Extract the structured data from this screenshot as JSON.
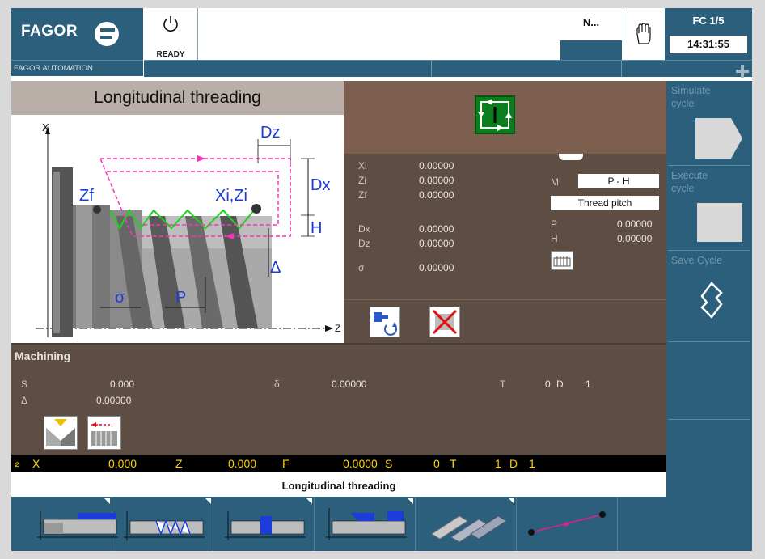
{
  "header": {
    "brand": "FAGOR",
    "brand_sub": "FAGOR AUTOMATION",
    "status": "READY",
    "message": "",
    "n_label": "N...",
    "fc_label": "FC 1/5",
    "time": "14:31:55"
  },
  "cycle": {
    "title": "Longitudinal threading",
    "footer_name": "Longitudinal threading"
  },
  "diagram_labels": {
    "x_axis": "X",
    "z_axis": "Z",
    "dz": "Dz",
    "dx": "Dx",
    "h": "H",
    "zf": "Zf",
    "xi_zi": "Xi,Zi",
    "delta": "Δ",
    "sigma": "σ",
    "p": "P"
  },
  "params": {
    "xi": {
      "label": "Xi",
      "value": "0.00000"
    },
    "zi": {
      "label": "Zi",
      "value": "0.00000"
    },
    "zf": {
      "label": "Zf",
      "value": "0.00000"
    },
    "dx": {
      "label": "Dx",
      "value": "0.00000"
    },
    "dz": {
      "label": "Dz",
      "value": "0.00000"
    },
    "sigma": {
      "label": "σ",
      "value": "0.00000"
    },
    "m": {
      "label": "M",
      "value": "P - H"
    },
    "thread_mode": "Thread pitch",
    "p": {
      "label": "P",
      "value": "0.00000"
    },
    "h": {
      "label": "H",
      "value": "0.00000"
    }
  },
  "machining": {
    "title": "Machining",
    "s": {
      "label": "S",
      "value": "0.000"
    },
    "delta": {
      "label": "Δ",
      "value": "0.00000"
    },
    "small_delta": {
      "label": "δ",
      "value": "0.00000"
    },
    "t": {
      "label": "T",
      "value": "0",
      "d_label": "D",
      "d_value": "1"
    }
  },
  "coords": {
    "dia": "⌀",
    "x_label": "X",
    "x_value": "0.000",
    "z_label": "Z",
    "z_value": "0.000",
    "f_label": "F",
    "f_value": "0.0000",
    "s_label": "S",
    "s_value": "0",
    "t_label": "T",
    "t_value": "1",
    "d_label": "D",
    "d_value": "1"
  },
  "softkeys": {
    "simulate": "Simulate cycle",
    "execute": "Execute cycle",
    "save": "Save Cycle"
  },
  "colors": {
    "panel_blue": "#2b5f7b",
    "panel_brown": "#5e4d43",
    "cycle_green": "#0c7d1c",
    "coord_yellow": "#ffd400"
  }
}
